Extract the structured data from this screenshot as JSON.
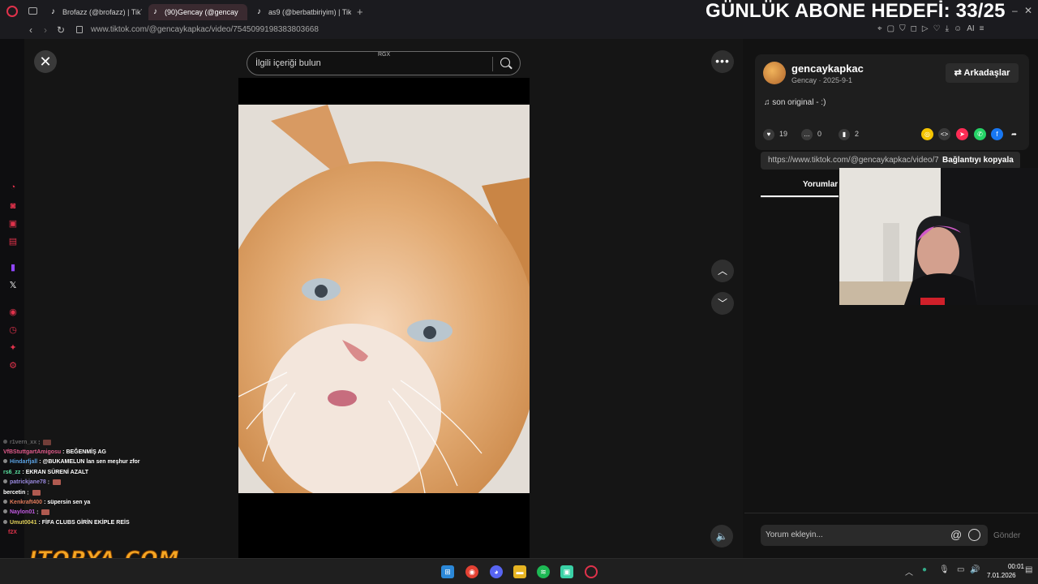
{
  "overlay": {
    "goal_text": "GÜNLÜK ABONE HEDEFİ: 33/25",
    "logo_text": "ITOPYA.COM"
  },
  "browser": {
    "tabs": [
      {
        "label": "Brofazz (@brofazz) | TikTo",
        "active": false
      },
      {
        "label": "(90)Gencay (@gencay",
        "active": true
      },
      {
        "label": "as9 (@berbatbiriyim) | Tik",
        "active": false
      }
    ],
    "url": "www.tiktok.com/@gencaykapkac/video/7545099198383803668",
    "ai_label": "AI"
  },
  "search": {
    "placeholder": "İlgili içeriği bulun",
    "watermark": "RGX"
  },
  "author": {
    "handle": "gencaykapkac",
    "subtitle": "Gencay · 2025-9-1",
    "friends_label": "Arkadaşlar",
    "music": "son original - :)"
  },
  "stats": {
    "likes": "19",
    "comments": "0",
    "saves": "2"
  },
  "share": {
    "link": "https://www.tiktok.com/@gencaykapkac/video/7545099198383803668",
    "copy_label": "Bağlantıyı kopyala"
  },
  "comments_tab": "Yorumlar",
  "comment_input": {
    "placeholder": "Yorum ekleyin...",
    "send_label": "Gönder"
  },
  "chat": [
    {
      "user": "r1vern_xx",
      "msg": "",
      "emote": true,
      "color": "#9a9a9a"
    },
    {
      "user": "VfBStuttgartAmigosu",
      "msg": "BEĞENMİŞ AG",
      "emote": false,
      "color": "#e05a8a"
    },
    {
      "user": "Hindarfjall",
      "msg": "@BUKAMELUN lan sen meşhur zfor",
      "emote": false,
      "color": "#5aa0e0"
    },
    {
      "user": "rs6_zz",
      "msg": "EKRAN SÜRENİ AZALT",
      "emote": false,
      "color": "#5ae0a0"
    },
    {
      "user": "patrickjane78",
      "msg": "",
      "emote": true,
      "color": "#9a8ae0"
    },
    {
      "user": "bercetin",
      "msg": "",
      "emote": true,
      "color": "#ffffff"
    },
    {
      "user": "Kenkraft400",
      "msg": "süpersin sen ya",
      "emote": false,
      "color": "#e07a5a"
    },
    {
      "user": "Naylon01",
      "msg": "",
      "emote": true,
      "color": "#c05ae0"
    },
    {
      "user": "Umut0041",
      "msg": "FİFA CLUBS GİRİN EKİPLE REİS",
      "emote": false,
      "color": "#e0d05a"
    }
  ],
  "chat_extra": "f2X",
  "clock": {
    "time": "00:01",
    "date": "7.01.2026"
  },
  "colors": {
    "accent": "#e0324b",
    "background": "#121212",
    "overlay_logo": "#f5a623"
  },
  "icons": {
    "close": "close-icon",
    "more": "more-icon",
    "up": "chevron-up-icon",
    "down": "chevron-down-icon",
    "volume": "volume-icon"
  }
}
